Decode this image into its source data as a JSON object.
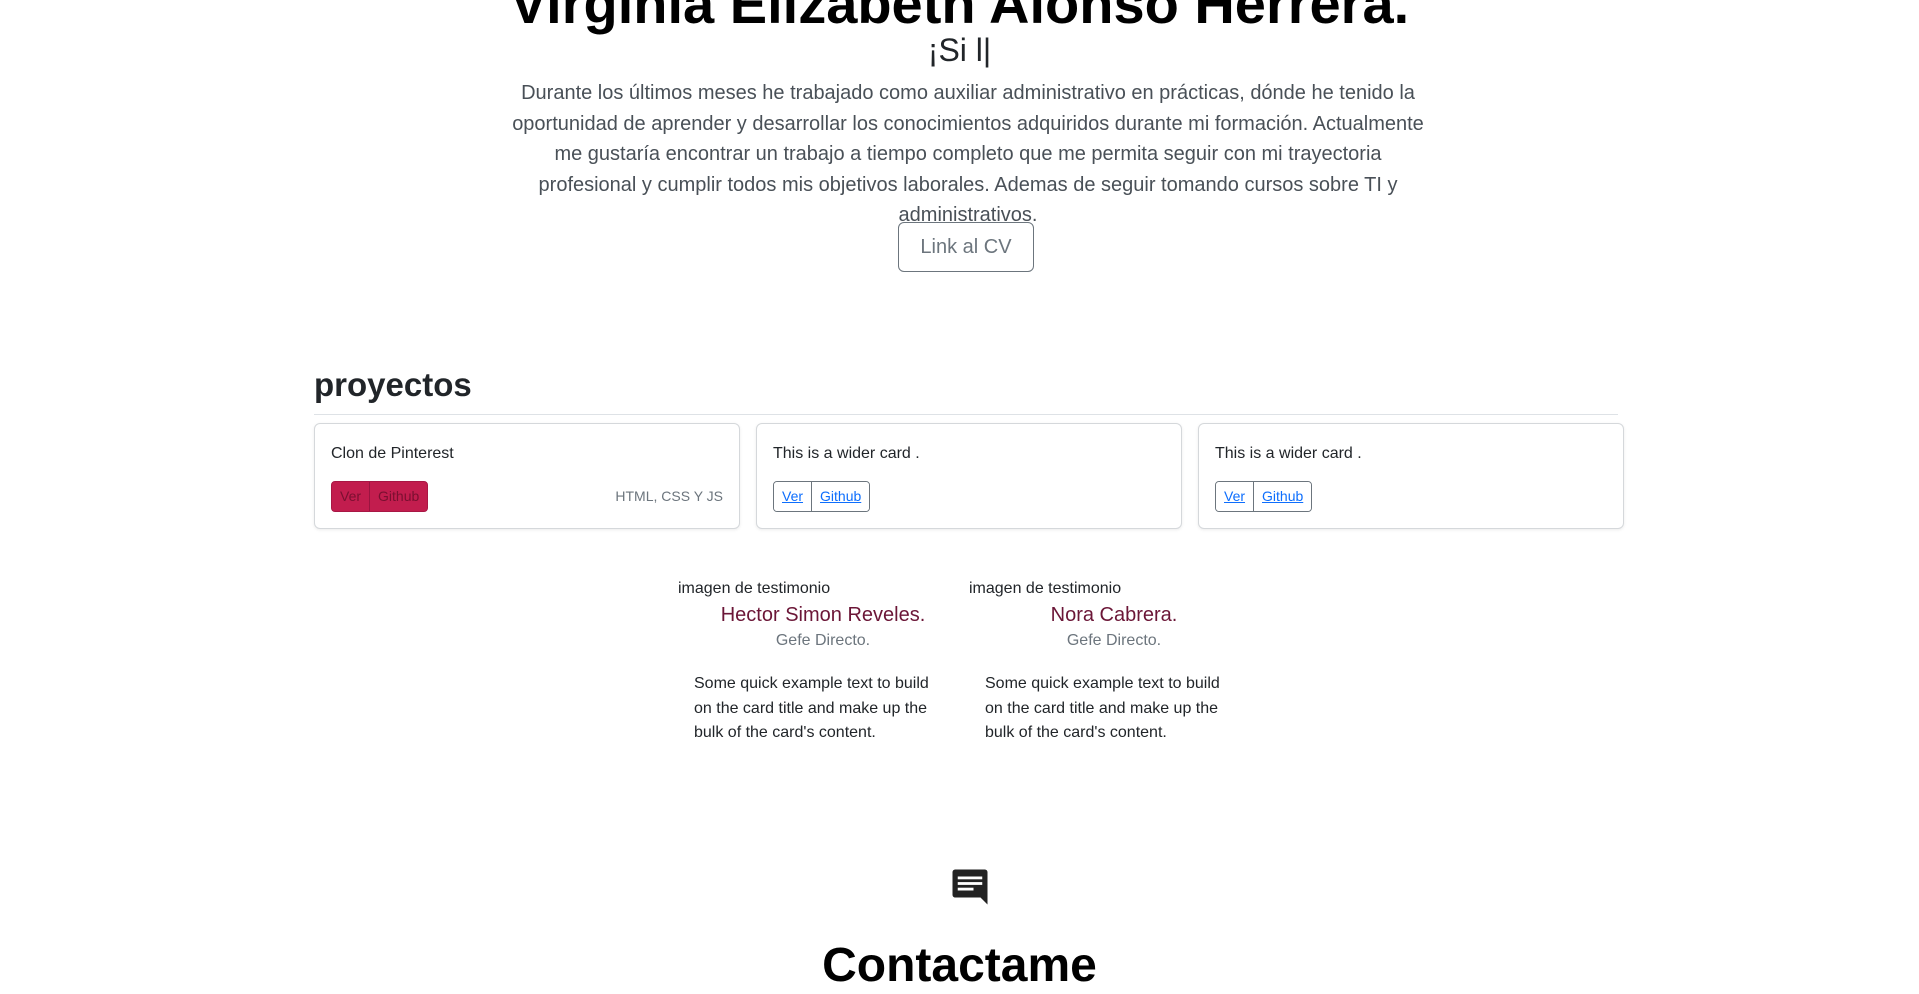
{
  "hero": {
    "name": "Virginia Elizabeth Alonso Herrera.",
    "typed_text": "¡Si l",
    "typed_cursor": "|",
    "bio": "Durante los últimos meses he trabajado como auxiliar administrativo en prácticas, dónde he tenido la oportunidad de aprender y desarrollar los conocimientos adquiridos durante mi formación. Actualmente me gustaría encontrar un trabajo a tiempo completo que me permita seguir con mi trayectoria profesional y cumplir todos mis objetivos laborales. Ademas de seguir tomando cursos sobre TI y administrativos.",
    "cv_button": "Link al CV"
  },
  "projects": {
    "title": "proyectos",
    "cards": [
      {
        "title": "Clon de Pinterest",
        "ver": "Ver",
        "github": "Github",
        "tech": "HTML, CSS Y JS",
        "style": "solid"
      },
      {
        "title": "This is a wider card .",
        "ver": "Ver",
        "github": "Github",
        "tech": "",
        "style": "outline"
      },
      {
        "title": "This is a wider card .",
        "ver": "Ver",
        "github": "Github",
        "tech": "",
        "style": "outline"
      }
    ]
  },
  "testimonials": [
    {
      "image_alt": "imagen de testimonio",
      "name": "Hector Simon Reveles.",
      "role": "Gefe Directo.",
      "text": "Some quick example text to build on the card title and make up the bulk of the card's content."
    },
    {
      "image_alt": "imagen de testimonio",
      "name": "Nora Cabrera.",
      "role": "Gefe Directo.",
      "text": "Some quick example text to build on the card title and make up the bulk of the card's content."
    }
  ],
  "contact": {
    "icon": "chat-icon",
    "title": "Contactame"
  },
  "colors": {
    "accent_red": "#c21d4e",
    "testimonial_name": "#6b1637",
    "link_blue": "#0d6efd",
    "muted": "#6c757d"
  }
}
